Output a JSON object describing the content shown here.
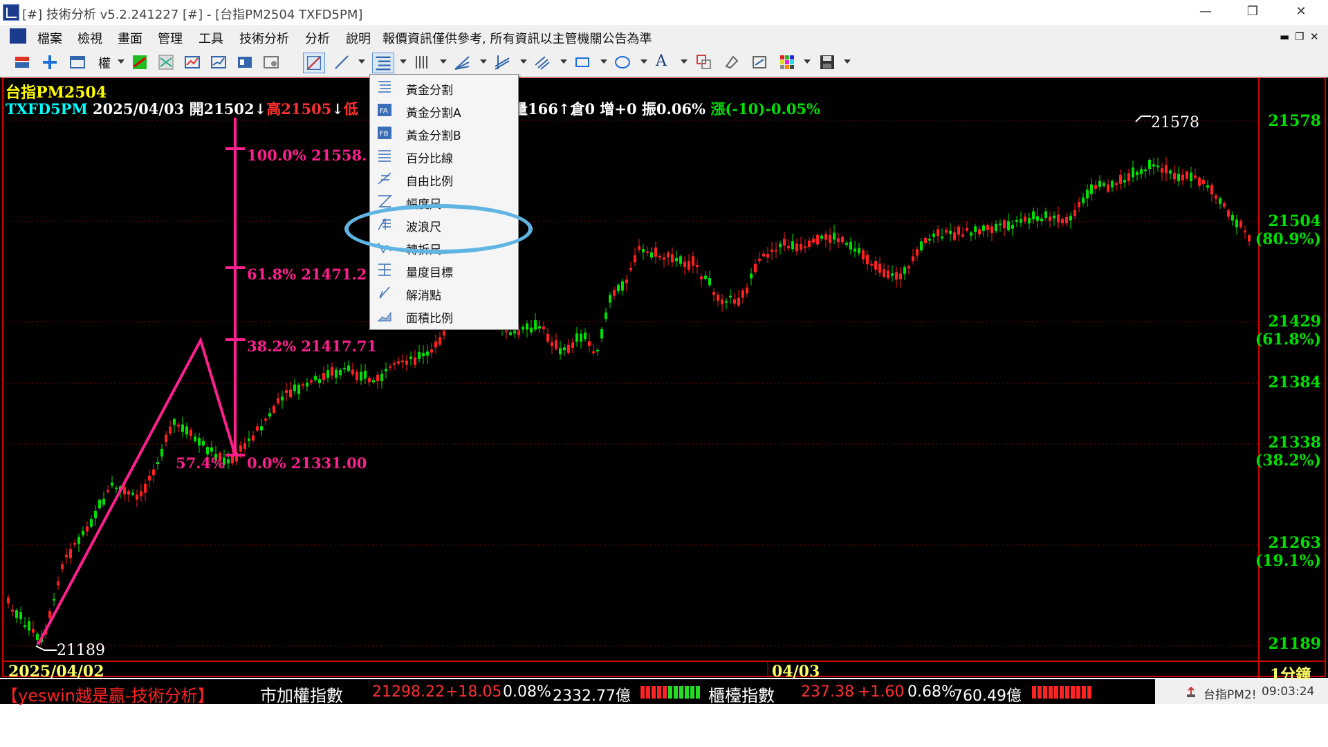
{
  "window": {
    "title": "[#] 技術分析 v5.2.241227 [#] - [台指PM2504 TXFD5PM]"
  },
  "menu": {
    "items": [
      "檔案",
      "檢視",
      "畫面",
      "管理",
      "工具",
      "技術分析",
      "分析",
      "說明"
    ],
    "notice": "報價資訊僅供參考, 所有資訊以主管機關公告為準"
  },
  "toolbar": {
    "quanwei_label": "權"
  },
  "chart": {
    "symbol": "台指PM2504",
    "info_line": {
      "code": "TXFD5PM",
      "date": "2025/04/03",
      "open": "開21502",
      "down_arrow_1": "↓",
      "high": "高21505",
      "down_arrow_2": "↓",
      "low": "低",
      "volume": "量166",
      "oi": "↑倉0",
      "inc": "增+0",
      "amp": "振0.06%",
      "change": "漲(-10)-0.05%"
    },
    "fib_levels": [
      {
        "text": "100.0% 21558."
      },
      {
        "text": "61.8% 21471.2"
      },
      {
        "text": "38.2% 21417.71"
      },
      {
        "text": "0.0% 21331.00"
      }
    ],
    "fib_extra": "57.4%",
    "point_labels": {
      "high": "21578",
      "low": "21189"
    },
    "y_axis": [
      {
        "value": "21578",
        "pct": ""
      },
      {
        "value": "21504",
        "pct": "(80.9%)"
      },
      {
        "value": "21429",
        "pct": "(61.8%)"
      },
      {
        "value": "21384",
        "pct": ""
      },
      {
        "value": "21338",
        "pct": "(38.2%)"
      },
      {
        "value": "21263",
        "pct": "(19.1%)"
      },
      {
        "value": "21189",
        "pct": ""
      }
    ],
    "x_axis": {
      "start": "2025/04/02",
      "mid": "04/03",
      "period": "1分鐘"
    },
    "colors": {
      "up": "#ff2020",
      "down": "#00e000",
      "fib": "#ff1f8f",
      "bg": "#000000"
    }
  },
  "dropdown": {
    "items": [
      {
        "label": "黃金分割",
        "icon": "golden-ratio-icon"
      },
      {
        "label": "黃金分割A",
        "icon": "golden-ratio-a-icon"
      },
      {
        "label": "黃金分割B",
        "icon": "golden-ratio-b-icon"
      },
      {
        "label": "百分比線",
        "icon": "percent-lines-icon"
      },
      {
        "label": "自由比例",
        "icon": "free-ratio-icon"
      },
      {
        "label": "幅度尺",
        "icon": "range-ruler-icon"
      },
      {
        "label": "波浪尺",
        "icon": "wave-ruler-icon"
      },
      {
        "label": "轉折尺",
        "icon": "turning-ruler-icon"
      },
      {
        "label": "量度目標",
        "icon": "measure-target-icon"
      },
      {
        "label": "解消點",
        "icon": "cancel-point-icon"
      },
      {
        "label": "面積比例",
        "icon": "area-ratio-icon"
      }
    ],
    "highlighted": "波浪尺"
  },
  "status": {
    "brand": "【yeswin越是贏-技術分析】",
    "index1_name": "市加權指數",
    "index1_value": "21298.22",
    "index1_change": "+18.05",
    "index1_pct": "0.08%",
    "index1_amount": "2332.77億",
    "index2_name": "櫃檯指數",
    "index2_value": "237.38",
    "index2_change": "+1.60",
    "index2_pct": "0.68%",
    "index2_amount": "760.49億",
    "symbol": "台指PM2!",
    "time": "09:03:24"
  }
}
